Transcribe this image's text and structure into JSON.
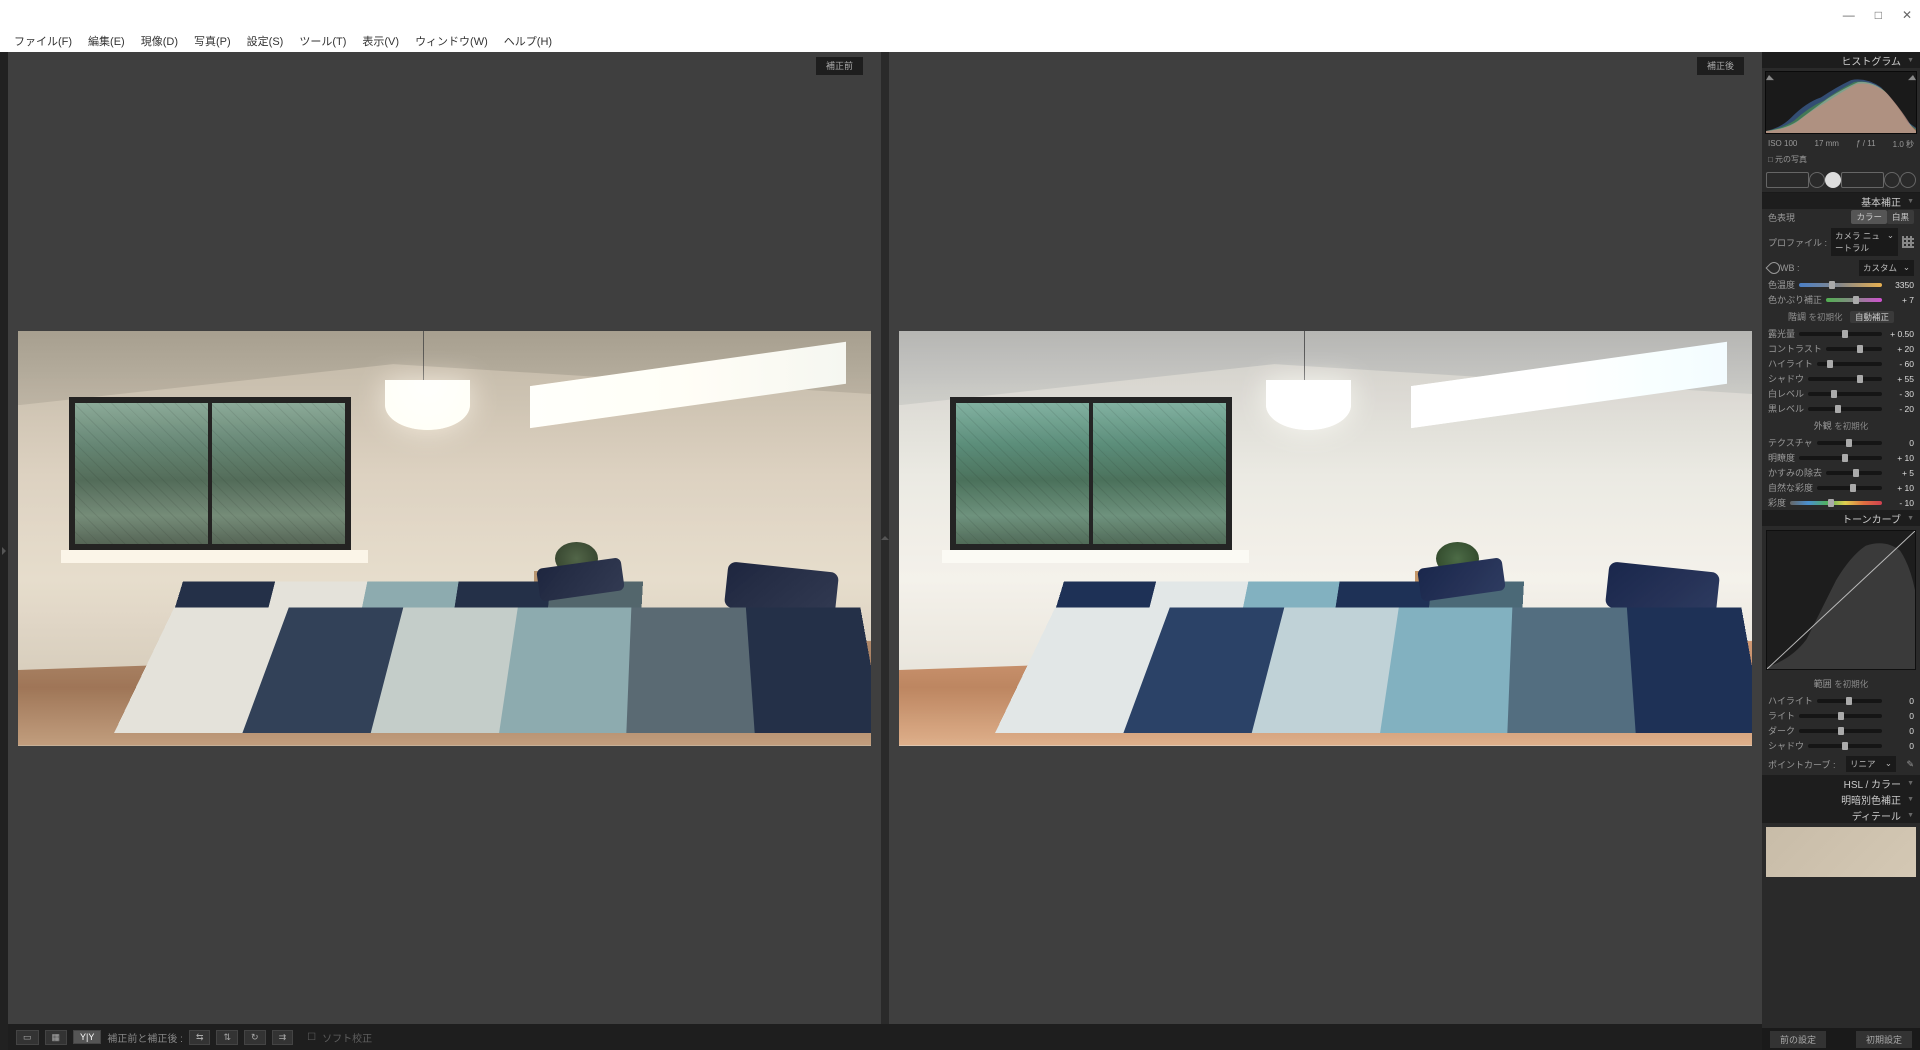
{
  "window": {
    "minimize": "—",
    "maximize": "□",
    "close": "✕"
  },
  "menu": {
    "file": "ファイル(F)",
    "edit": "編集(E)",
    "develop": "現像(D)",
    "photo": "写真(P)",
    "settings": "設定(S)",
    "tools": "ツール(T)",
    "view": "表示(V)",
    "window": "ウィンドウ(W)",
    "help": "ヘルプ(H)"
  },
  "compare": {
    "before": "補正前",
    "after": "補正後"
  },
  "toolbar": {
    "mode_label": "補正前と補正後 :",
    "soft": "ソフト校正"
  },
  "histogram": {
    "title": "ヒストグラム",
    "iso": "ISO 100",
    "focal": "17 mm",
    "aperture": "ƒ / 11",
    "shutter": "1.0 秒",
    "source": "□ 元の写真"
  },
  "basic": {
    "title": "基本補正",
    "treatment": "色表現",
    "color": "カラー",
    "bw": "白黒",
    "profile": "プロファイル :",
    "profile_value": "カメラ ニュートラル",
    "wb": "WB :",
    "wb_value": "カスタム",
    "temp": "色温度",
    "temp_val": "3350",
    "tint": "色かぶり補正",
    "tint_val": "+ 7",
    "tone": "階調",
    "tone_reset": "を初期化",
    "auto": "自動補正",
    "exposure": "露光量",
    "exposure_val": "+ 0.50",
    "contrast": "コントラスト",
    "contrast_val": "+ 20",
    "highlights": "ハイライト",
    "highlights_val": "- 60",
    "shadows": "シャドウ",
    "shadows_val": "+ 55",
    "whites": "白レベル",
    "whites_val": "- 30",
    "blacks": "黒レベル",
    "blacks_val": "- 20",
    "presence": "外観",
    "presence_reset": "を初期化",
    "texture": "テクスチャ",
    "texture_val": "0",
    "clarity": "明瞭度",
    "clarity_val": "+ 10",
    "dehaze": "かすみの除去",
    "dehaze_val": "+ 5",
    "vibrance": "自然な彩度",
    "vibrance_val": "+ 10",
    "saturation": "彩度",
    "saturation_val": "- 10"
  },
  "tonecurve": {
    "title": "トーンカーブ",
    "range": "範囲",
    "range_reset": "を初期化",
    "highlights": "ハイライト",
    "lights": "ライト",
    "darks": "ダーク",
    "shadows": "シャドウ",
    "val": "0",
    "pointcurve": "ポイントカーブ :",
    "linear": "リニア"
  },
  "hsl": {
    "title": "HSL / カラー"
  },
  "split": {
    "title": "明暗別色補正"
  },
  "detail": {
    "title": "ディテール"
  },
  "bottom": {
    "prev": "前の設定",
    "reset": "初期設定"
  }
}
